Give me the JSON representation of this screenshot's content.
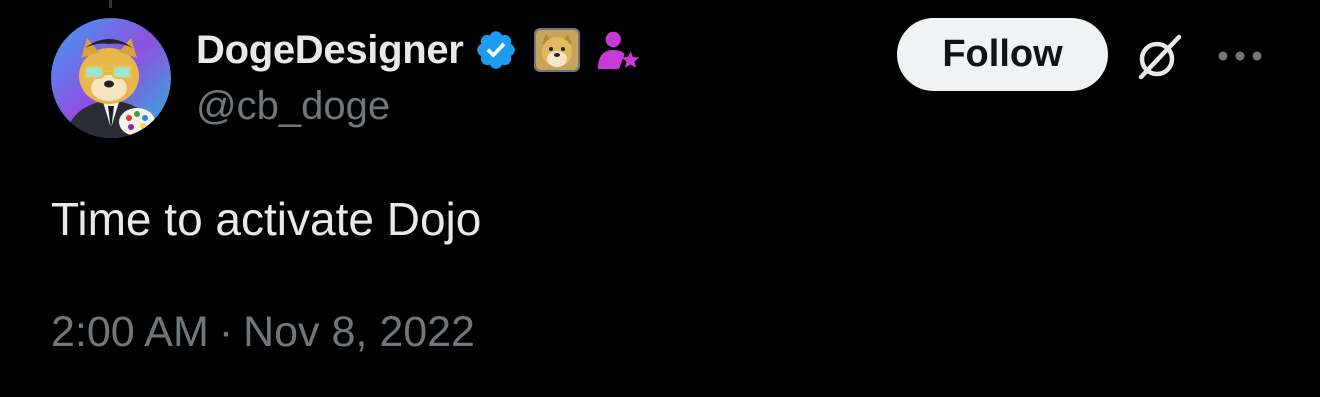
{
  "tweet": {
    "author": {
      "display_name": "DogeDesigner",
      "handle": "@cb_doge",
      "avatar_icon": "doge-with-sunglasses-and-palette-avatar",
      "badges": [
        "verified-check-icon",
        "doge-badge-icon",
        "affiliate-person-star-icon"
      ],
      "verified_color": "#1d9bf0",
      "affiliate_color": "#c63bd6"
    },
    "follow_label": "Follow",
    "actions": [
      "grok-icon",
      "more-icon"
    ],
    "text": "Time to activate Dojo",
    "timestamp": {
      "time": "2:00 AM",
      "separator": "·",
      "date": "Nov 8, 2022"
    }
  },
  "colors": {
    "background": "#000000",
    "primary_text": "#e7e9ea",
    "secondary_text": "#71767b",
    "follow_button_bg": "#eff3f4",
    "follow_button_text": "#0f1419"
  }
}
